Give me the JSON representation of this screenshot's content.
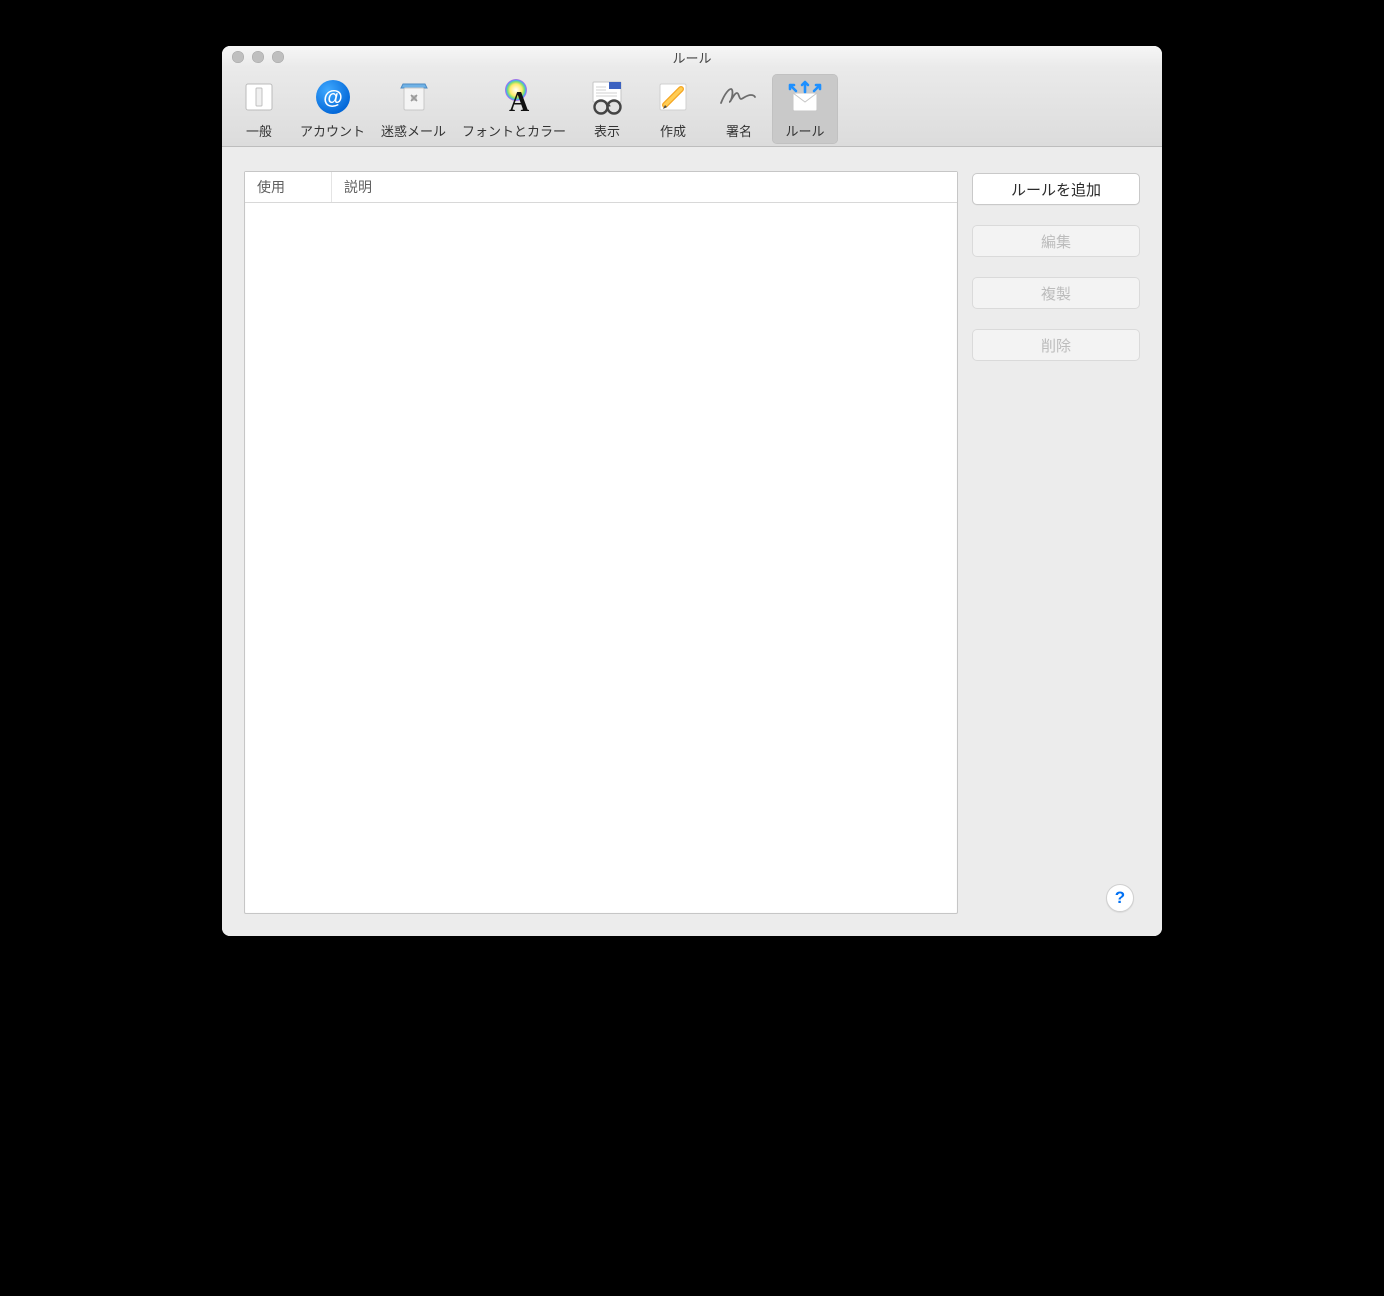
{
  "window": {
    "title": "ルール"
  },
  "toolbar": {
    "items": [
      {
        "label": "一般"
      },
      {
        "label": "アカウント"
      },
      {
        "label": "迷惑メール"
      },
      {
        "label": "フォントとカラー"
      },
      {
        "label": "表示"
      },
      {
        "label": "作成"
      },
      {
        "label": "署名"
      },
      {
        "label": "ルール"
      }
    ],
    "selected_index": 7
  },
  "table": {
    "columns": {
      "use": "使用",
      "description": "説明"
    },
    "rows": []
  },
  "actions": {
    "add": {
      "label": "ルールを追加",
      "enabled": true
    },
    "edit": {
      "label": "編集",
      "enabled": false
    },
    "duplicate": {
      "label": "複製",
      "enabled": false
    },
    "delete": {
      "label": "削除",
      "enabled": false
    }
  },
  "help_glyph": "?"
}
